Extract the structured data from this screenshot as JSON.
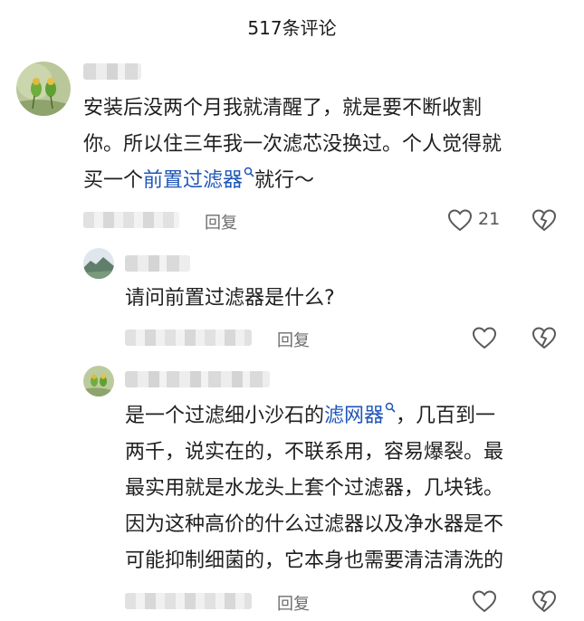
{
  "header": {
    "title": "517条评论"
  },
  "comments": [
    {
      "text_lines": [
        "安装后没两个月我就清醒了，就是要不断收割",
        "你。所以住三年我一次滤芯没换过。个人觉得就"
      ],
      "last_line": {
        "before": "买一个",
        "link": "前置过滤器",
        "after": "就行～"
      },
      "reply_label": "回复",
      "like_count": "21"
    },
    {
      "text_lines": [
        "请问前置过滤器是什么?"
      ],
      "reply_label": "回复"
    },
    {
      "first_line": {
        "before": "是一个过滤细小沙石的",
        "link": "滤网器",
        "after": "，几百到一"
      },
      "text_lines": [
        "两千，说实在的，不联系用，容易爆裂。最",
        "最实用就是水龙头上套个过滤器，几块钱。",
        "因为这种高价的什么过滤器以及净水器是不",
        "可能抑制细菌的，它本身也需要清洁清洗的"
      ],
      "reply_label": "回复"
    }
  ]
}
